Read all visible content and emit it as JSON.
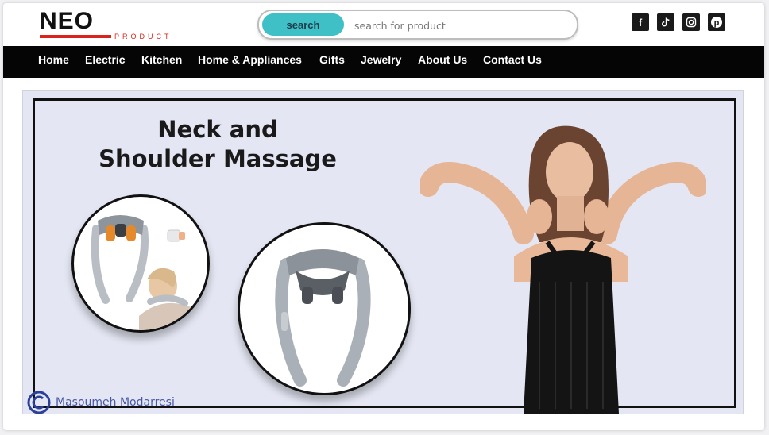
{
  "brand": {
    "name": "NEO",
    "subtitle": "PRODUCT",
    "accent_color": "#d8241c"
  },
  "search": {
    "button_label": "search",
    "placeholder": "search for product",
    "button_color": "#3fc0c7"
  },
  "social": [
    {
      "icon": "facebook-icon",
      "glyph": "f"
    },
    {
      "icon": "tiktok-icon",
      "glyph": "♪"
    },
    {
      "icon": "instagram-icon",
      "glyph": ""
    },
    {
      "icon": "pinterest-icon",
      "glyph": "p"
    }
  ],
  "nav": {
    "items": [
      {
        "label": "Home"
      },
      {
        "label": "Electric"
      },
      {
        "label": "Kitchen"
      },
      {
        "label": "Home & Appliances"
      },
      {
        "label": "Gifts"
      },
      {
        "label": "Jewelry"
      },
      {
        "label": "About Us"
      },
      {
        "label": "Contact Us"
      }
    ]
  },
  "banner": {
    "title_line1": "Neck and",
    "title_line2": "Shoulder Massage",
    "background_color": "#e4e7f3"
  },
  "watermark": {
    "text": "Masoumeh Modarresi",
    "color": "#2c3f9a"
  }
}
